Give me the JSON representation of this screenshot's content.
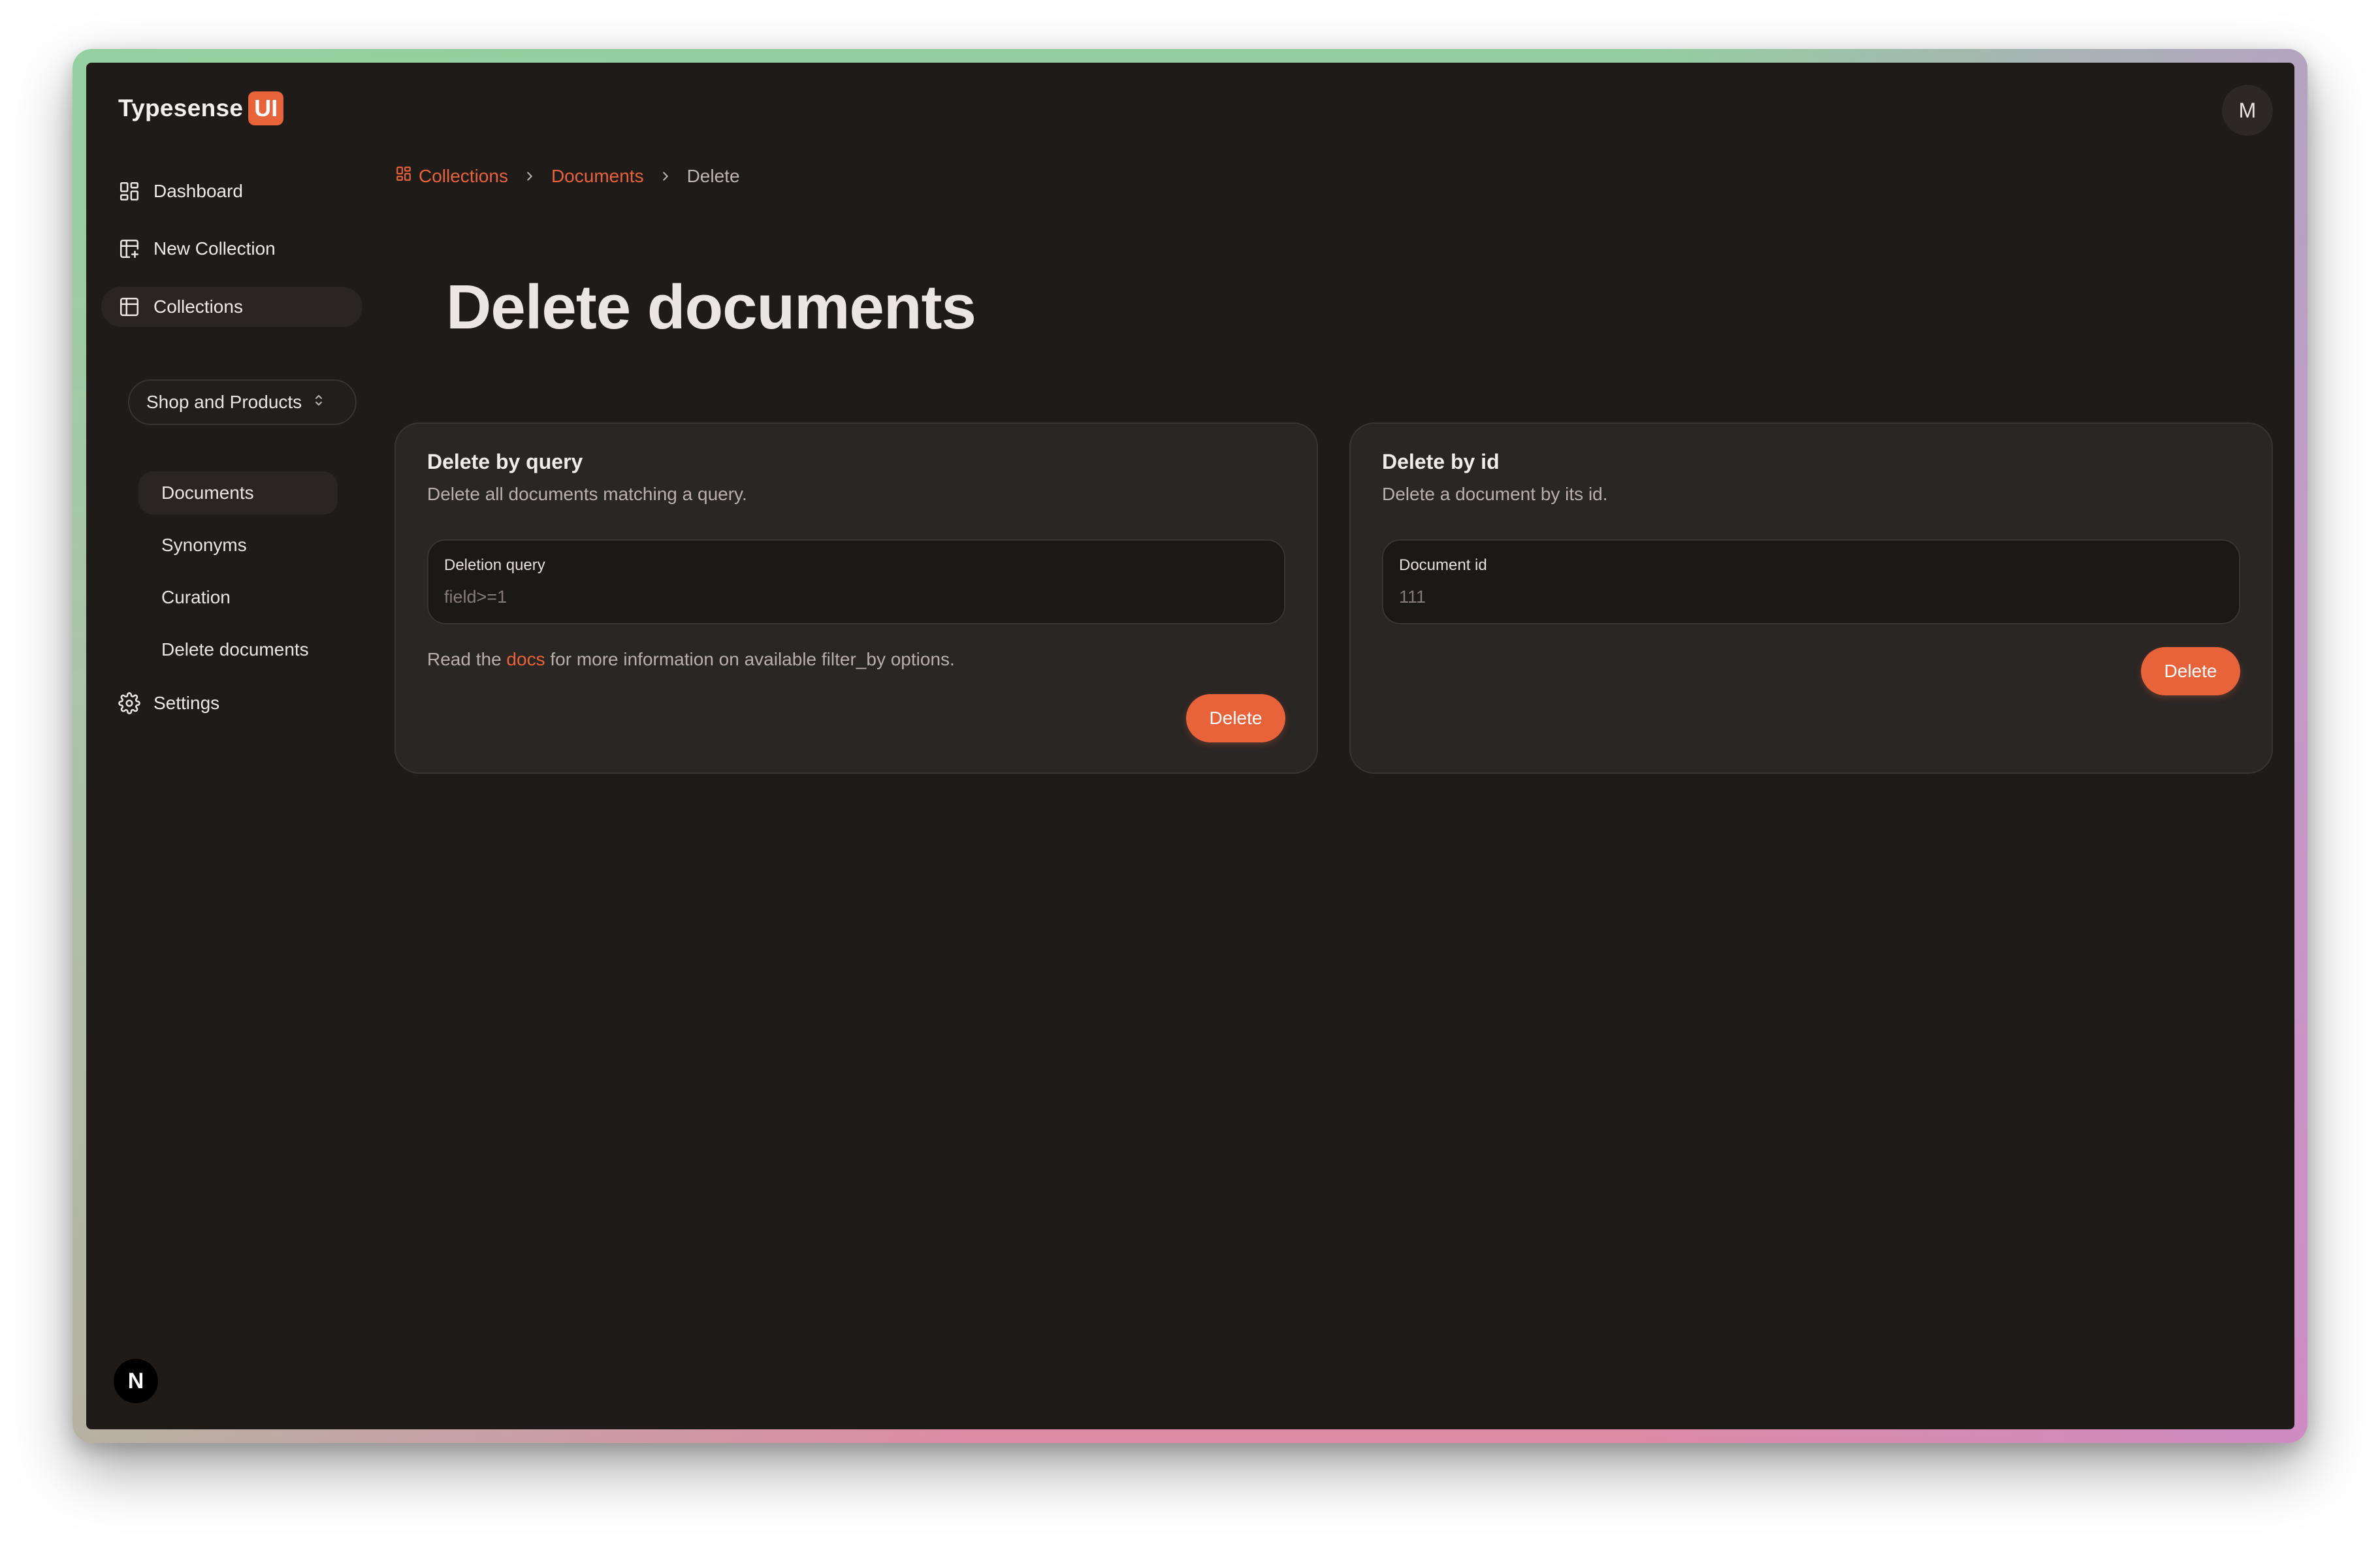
{
  "brand": {
    "name": "Typesense",
    "badge": "UI"
  },
  "user": {
    "avatar_initial": "M"
  },
  "sidebar": {
    "items": [
      {
        "label": "Dashboard",
        "icon": "dashboard-icon"
      },
      {
        "label": "New Collection",
        "icon": "table-plus-icon"
      },
      {
        "label": "Collections",
        "icon": "table-icon"
      },
      {
        "label": "Settings",
        "icon": "gear-icon"
      }
    ],
    "collection_select": {
      "value": "Shop and Products"
    },
    "sub_items": [
      {
        "label": "Documents"
      },
      {
        "label": "Synonyms"
      },
      {
        "label": "Curation"
      },
      {
        "label": "Delete documents"
      }
    ],
    "footer_badge": "N"
  },
  "breadcrumb": {
    "items": [
      {
        "label": "Collections",
        "icon": "grid-icon"
      },
      {
        "label": "Documents"
      },
      {
        "label": "Delete"
      }
    ]
  },
  "page": {
    "title": "Delete documents"
  },
  "cards": {
    "by_query": {
      "title": "Delete by query",
      "description": "Delete all documents matching a query.",
      "field_label": "Deletion query",
      "field_placeholder": "field>=1",
      "hint_prefix": "Read the",
      "hint_link": "docs",
      "hint_suffix": "for more information on available filter_by options.",
      "button": "Delete"
    },
    "by_id": {
      "title": "Delete by id",
      "description": "Delete a document by its id.",
      "field_label": "Document id",
      "field_placeholder": "111",
      "button": "Delete"
    }
  },
  "colors": {
    "accent": "#e8623a",
    "background": "#1f1b19",
    "card": "#2a2624"
  }
}
